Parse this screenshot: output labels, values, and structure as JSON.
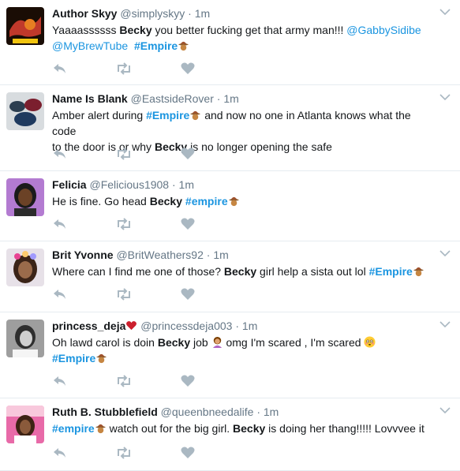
{
  "accent_color": "#1b95e0",
  "muted_color": "#aab8c2",
  "tweets": [
    {
      "name": "Author Skyy",
      "handle": "@simplyskyy",
      "dot": "·",
      "time": "1m",
      "line1": {
        "a": "Yaaaassssss ",
        "b": "Becky",
        "c": " you better fucking get that army man!!! ",
        "link": "@GabbySidibe"
      },
      "line2": {
        "link": "@MyBrewTube",
        "tag": "#Empire"
      }
    },
    {
      "name": "Name Is Blank",
      "handle": "@EastsideRover",
      "dot": "·",
      "time": "1m",
      "line1": {
        "a": "Amber alert during ",
        "tag": "#Empire",
        "c": " and now no one in Atlanta knows what the code"
      },
      "line2": {
        "a": "to the door is or why ",
        "b": "Becky",
        "c": " is no longer opening the safe"
      }
    },
    {
      "name": "Felicia",
      "handle": "@Felicious1908",
      "dot": "·",
      "time": "1m",
      "line1": {
        "a": "He is fine. Go head ",
        "b": "Becky",
        "tag": "#empire"
      }
    },
    {
      "name": "Brit Yvonne",
      "handle": "@BritWeathers92",
      "dot": "·",
      "time": "1m",
      "line1": {
        "a": "Where can I find me one of those? ",
        "b": "Becky",
        "c": " girl help a sista out lol ",
        "tag": "#Empire"
      }
    },
    {
      "name": "princess_deja",
      "handle": "@princessdeja003",
      "dot": "·",
      "time": "1m",
      "line1": {
        "a": "Oh lawd carol is doin ",
        "b": "Becky",
        "c": " job ",
        "d": " omg I'm scared , I'm scared "
      },
      "line2": {
        "tag": "#Empire"
      }
    },
    {
      "name": "Ruth B. Stubblefield",
      "handle": "@queenbneedalife",
      "dot": "·",
      "time": "1m",
      "line1": {
        "tag": "#empire",
        "c": " watch out for the big girl. ",
        "b": "Becky",
        "d": " is doing her thang!!!!! Lovvvee it"
      }
    }
  ],
  "actions": [
    "reply-icon",
    "retweet-icon",
    "like-icon"
  ]
}
